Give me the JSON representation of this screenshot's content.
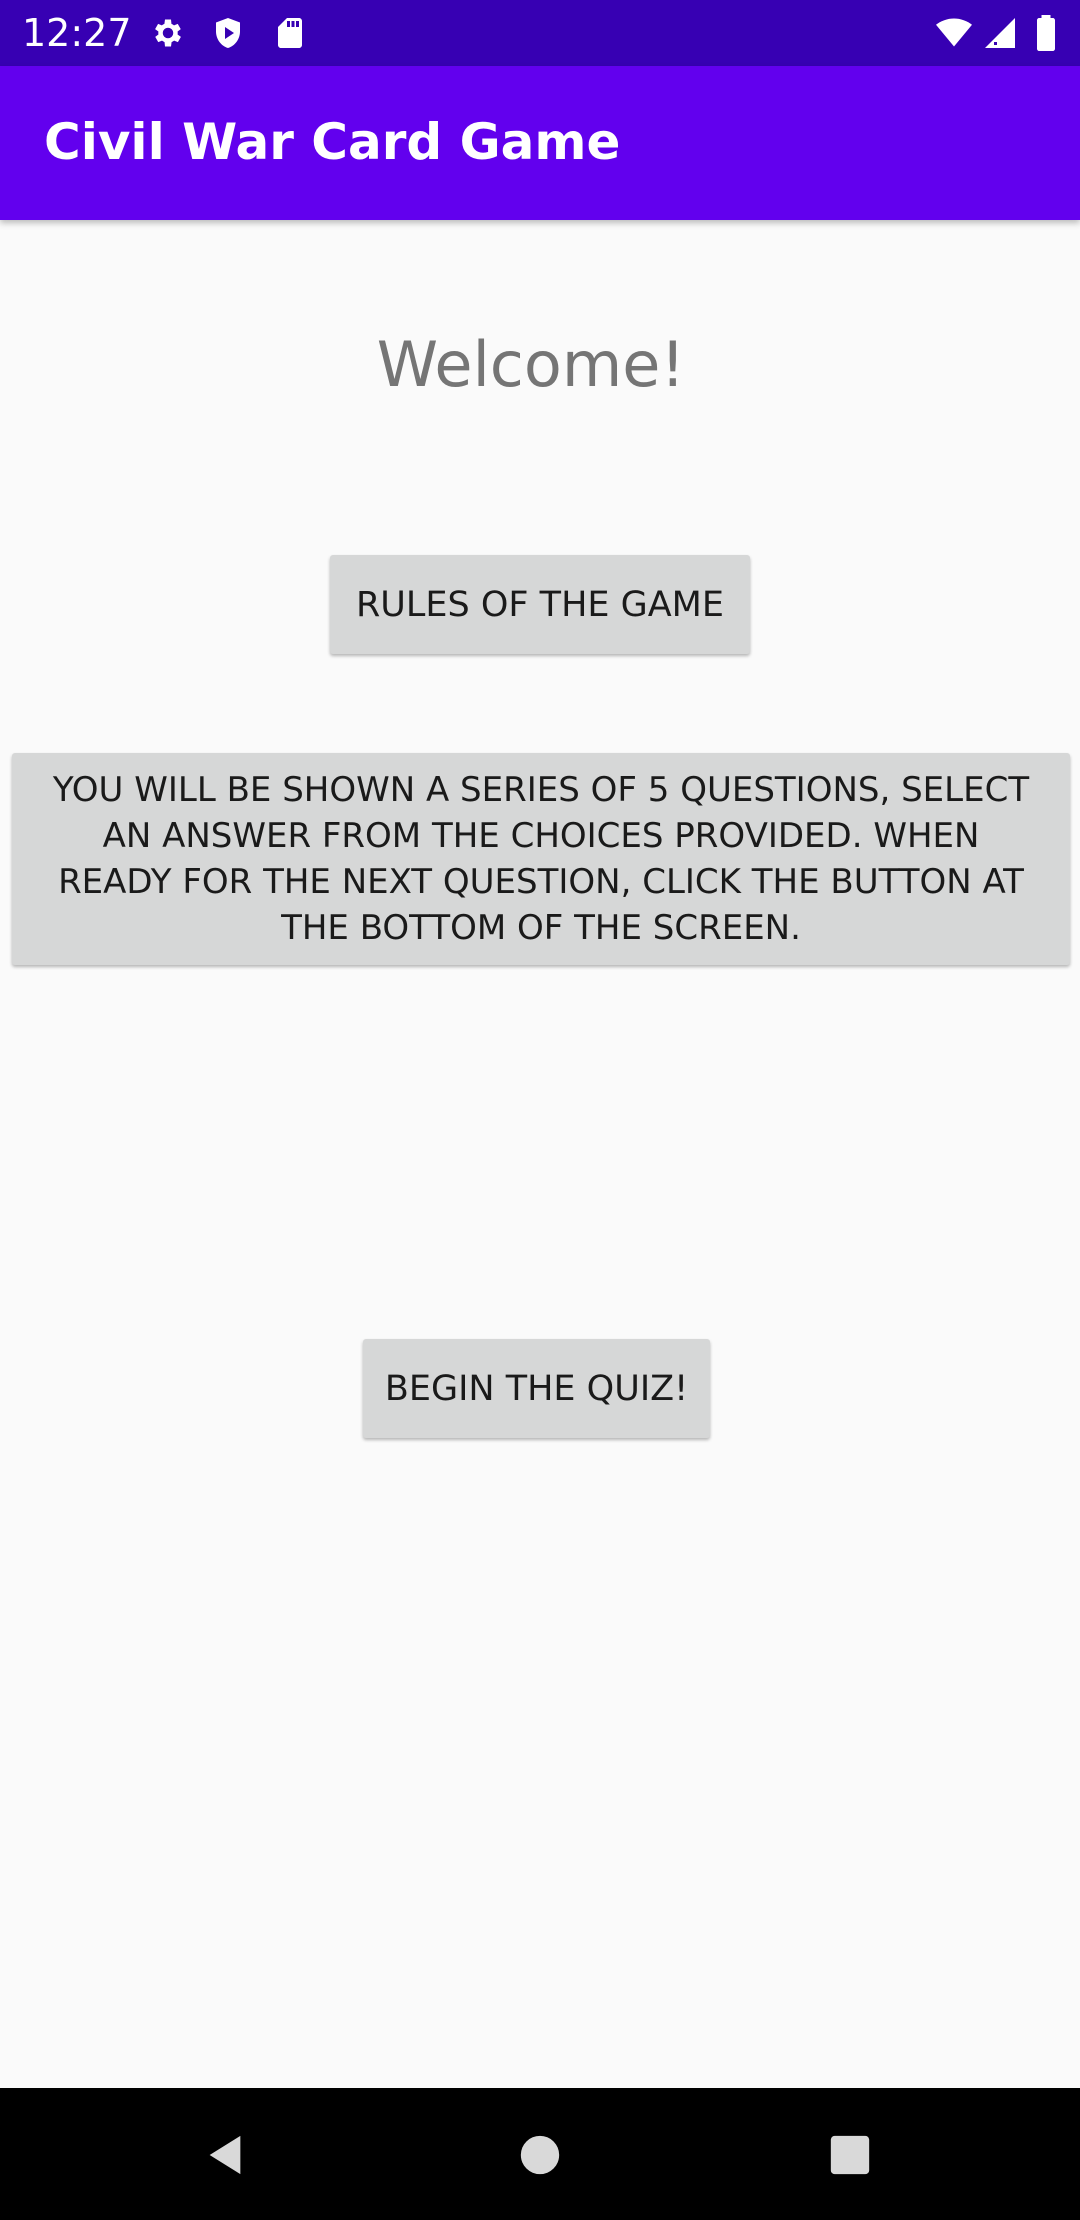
{
  "status_bar": {
    "time": "12:27",
    "icons_left": [
      "gear-icon",
      "shield-icon",
      "sd-card-icon"
    ],
    "icons_right": [
      "wifi-icon",
      "signal-icon",
      "battery-icon"
    ]
  },
  "app_bar": {
    "title": "Civil War Card Game"
  },
  "main": {
    "welcome_text": "Welcome!",
    "rules_button_label": "RULES OF THE GAME",
    "rules_text": "YOU WILL BE SHOWN A SERIES OF 5 QUESTIONS, SELECT AN ANSWER FROM THE CHOICES PROVIDED. WHEN READY FOR THE NEXT QUESTION, CLICK THE BUTTON AT THE BOTTOM OF THE SCREEN.",
    "begin_button_label": "BEGIN THE QUIZ!"
  },
  "nav_bar": {
    "icons": [
      "back-icon",
      "home-icon",
      "recents-icon"
    ]
  },
  "colors": {
    "status_bar": "#3700b3",
    "app_bar": "#6200ee",
    "background": "#fafafa",
    "button": "#d6d7d7",
    "welcome_text": "#757575"
  }
}
